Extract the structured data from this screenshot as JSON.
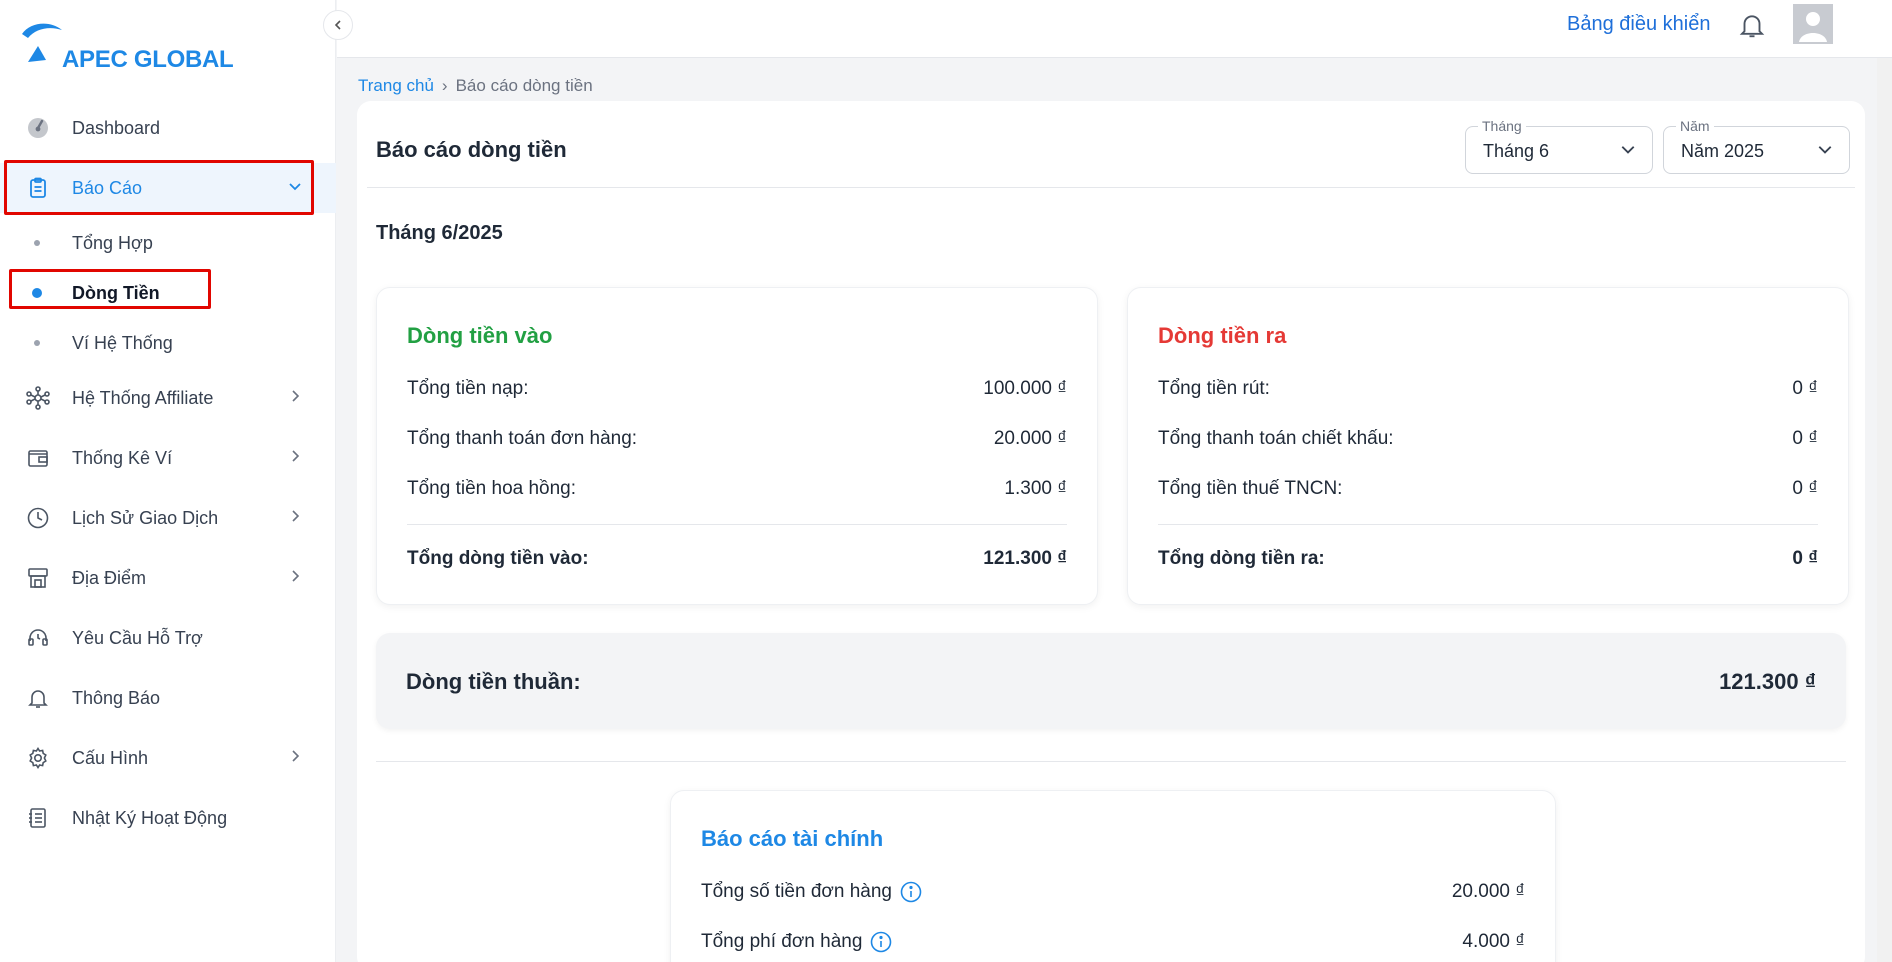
{
  "brand": {
    "name": "APEC GLOBAL",
    "color": "#1e88e5"
  },
  "topbar": {
    "dashboard_link": "Bảng điều khiển",
    "bell_icon": "bell-icon",
    "avatar_icon": "user-avatar-icon"
  },
  "sidebar": {
    "items": [
      {
        "label": "Dashboard",
        "icon": "gauge-icon"
      },
      {
        "label": "Báo Cáo",
        "icon": "clipboard-icon",
        "active": true,
        "expanded": true
      },
      {
        "label": "Hệ Thống Affiliate",
        "icon": "network-icon"
      },
      {
        "label": "Thống Kê Ví",
        "icon": "wallet-icon"
      },
      {
        "label": "Lịch Sử Giao Dịch",
        "icon": "clock-icon"
      },
      {
        "label": "Địa Điểm",
        "icon": "store-icon"
      },
      {
        "label": "Yêu Cầu Hỗ Trợ",
        "icon": "headset-icon"
      },
      {
        "label": "Thông Báo",
        "icon": "bell-icon"
      },
      {
        "label": "Cấu Hình",
        "icon": "gear-icon"
      },
      {
        "label": "Nhật Ký Hoạt Động",
        "icon": "log-icon"
      }
    ],
    "sub_items": [
      {
        "label": "Tổng Hợp"
      },
      {
        "label": "Dòng Tiền",
        "active": true
      },
      {
        "label": "Ví Hệ Thống"
      }
    ]
  },
  "breadcrumb": {
    "home": "Trang chủ",
    "current": "Báo cáo dòng tiền"
  },
  "page": {
    "title": "Báo cáo dòng tiền",
    "month_select": {
      "legend": "Tháng",
      "value": "Tháng 6"
    },
    "year_select": {
      "legend": "Năm",
      "value": "Năm 2025"
    },
    "period": "Tháng 6/2025"
  },
  "cash_in": {
    "title": "Dòng tiền vào",
    "color": "#22a043",
    "rows": [
      {
        "label": "Tổng tiền nạp:",
        "value": "100.000 ₫"
      },
      {
        "label": "Tổng thanh toán đơn hàng:",
        "value": "20.000 ₫"
      },
      {
        "label": "Tổng tiền hoa hồng:",
        "value": "1.300 ₫"
      }
    ],
    "total": {
      "label": "Tổng dòng tiền vào:",
      "value": "121.300 ₫"
    }
  },
  "cash_out": {
    "title": "Dòng tiền ra",
    "color": "#e53935",
    "rows": [
      {
        "label": "Tổng tiền rút:",
        "value": "0 ₫"
      },
      {
        "label": "Tổng thanh toán chiết khấu:",
        "value": "0 ₫"
      },
      {
        "label": "Tổng tiền thuế TNCN:",
        "value": "0 ₫"
      }
    ],
    "total": {
      "label": "Tổng dòng tiền ra:",
      "value": "0 ₫"
    }
  },
  "net": {
    "label": "Dòng tiền thuần:",
    "value": "121.300 ₫"
  },
  "financial": {
    "title": "Báo cáo tài chính",
    "color": "#1e88e5",
    "rows": [
      {
        "label": "Tổng số tiền đơn hàng",
        "value": "20.000 ₫"
      },
      {
        "label": "Tổng phí đơn hàng",
        "value": "4.000 ₫"
      }
    ]
  }
}
